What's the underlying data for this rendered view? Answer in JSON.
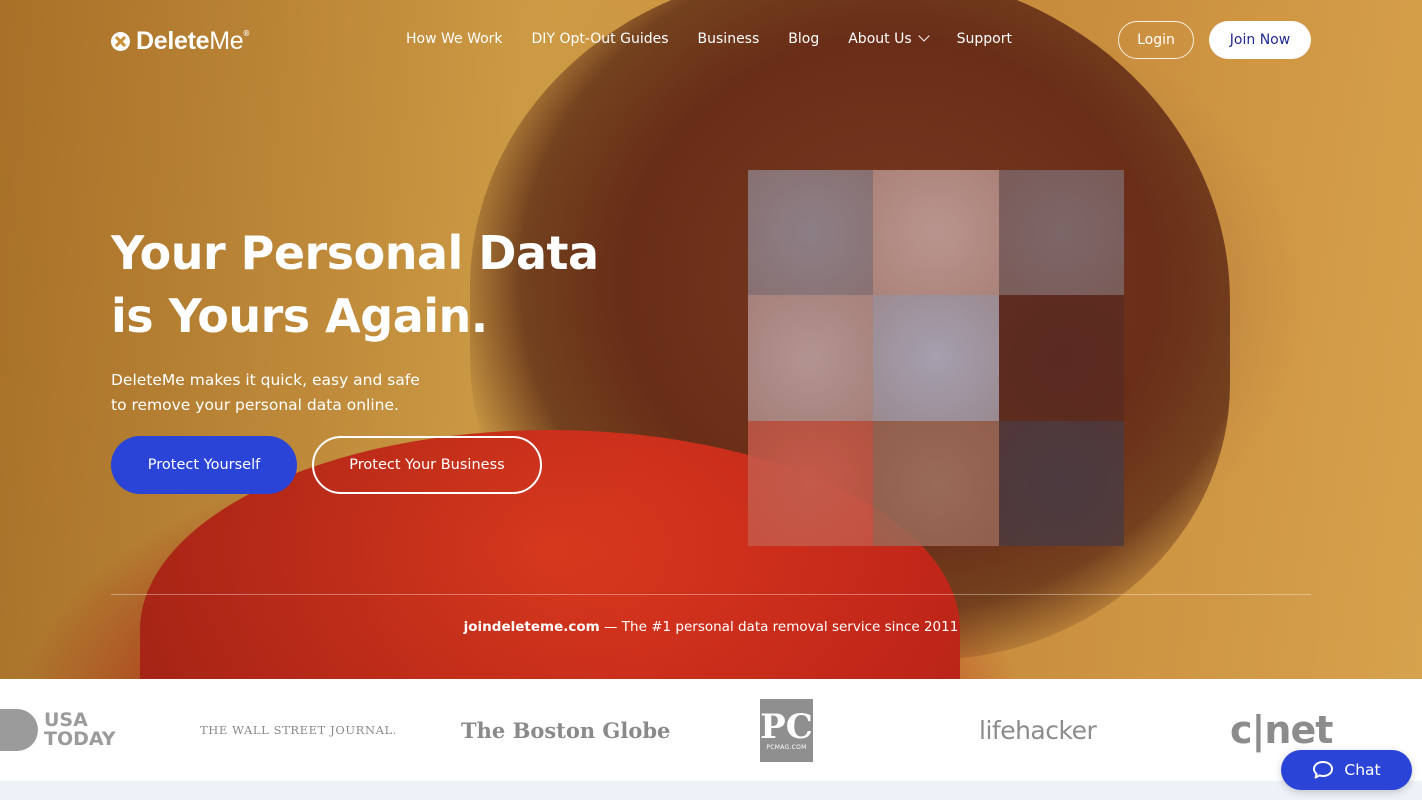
{
  "brand": {
    "name_bold": "Delete",
    "name_light": "Me",
    "trademark": "®",
    "logo_icon": "x-circle-icon"
  },
  "nav": {
    "items": [
      {
        "label": "How We Work"
      },
      {
        "label": "DIY Opt-Out Guides"
      },
      {
        "label": "Business"
      },
      {
        "label": "Blog"
      },
      {
        "label": "About Us"
      },
      {
        "label": "Support"
      }
    ],
    "login": "Login",
    "join": "Join Now"
  },
  "hero": {
    "headline_line1": "Your Personal Data",
    "headline_line2": "is Yours Again.",
    "sub_line1": "DeleteMe makes it quick, easy and safe",
    "sub_line2": "to remove your personal data online.",
    "cta_primary": "Protect Yourself",
    "cta_secondary": "Protect Your Business",
    "tagline_domain": "joindeleteme.com",
    "tagline_rest": " — The #1 personal data removal service since 2011",
    "pixelated_tiles": [
      "#8d7f86",
      "#b9958f",
      "#7d6668",
      "#b39391",
      "#a59fae",
      "#5a2a20",
      "#c45a4a",
      "#9a6a58",
      "#4b3a40"
    ]
  },
  "press": {
    "usa_today_line1": "USA",
    "usa_today_line2": "TODAY",
    "wsj": "THE WALL STREET JOURNAL.",
    "boston_globe": "The Boston Globe",
    "pcmag_big": "PC",
    "pcmag_small": "PCMAG.COM",
    "lifehacker": "lifehacker",
    "cnet": "c|net"
  },
  "chat": {
    "label": "Chat",
    "icon": "chat-bubble-icon"
  },
  "colors": {
    "accent_blue": "#2b44d8",
    "join_text": "#1f2b8f",
    "hero_bg": "#d9a54a",
    "sweater_red": "#d9331f"
  }
}
